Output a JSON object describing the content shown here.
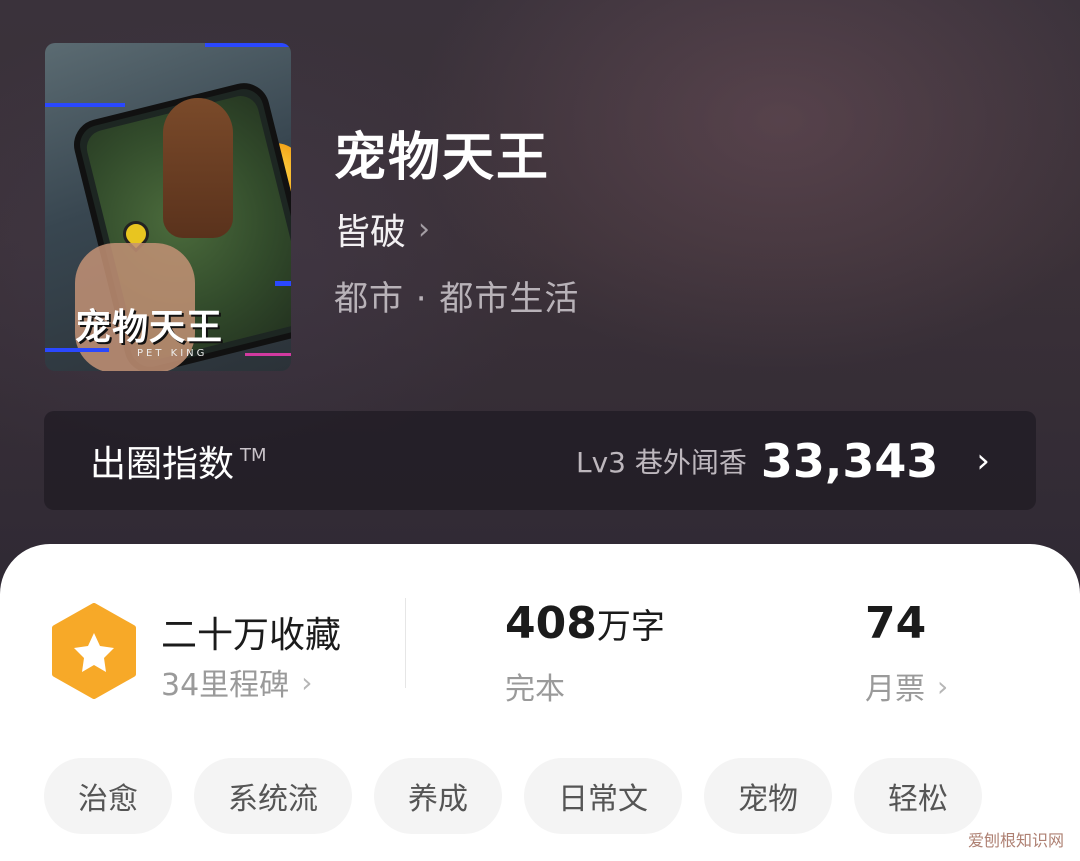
{
  "book": {
    "title": "宠物天王",
    "author": "皆破",
    "genre": "都市 · 都市生活",
    "cover": {
      "title": "宠物天王",
      "subtitle": "PET KING"
    }
  },
  "index": {
    "label": "出圈指数",
    "tm": "TM",
    "level": "Lv3 巷外闻香",
    "value": "33,343"
  },
  "stats": {
    "collect": {
      "label": "二十万收藏",
      "sub": "34里程碑"
    },
    "words": {
      "number": "408",
      "unit": "万字",
      "status": "完本"
    },
    "votes": {
      "number": "74",
      "label": "月票"
    }
  },
  "tags": [
    "治愈",
    "系统流",
    "养成",
    "日常文",
    "宠物",
    "轻松"
  ],
  "watermark": "爱刨根知识网",
  "colors": {
    "badge": "#f7a928",
    "card": "#ffffff",
    "tag_bg": "#f4f4f4"
  }
}
